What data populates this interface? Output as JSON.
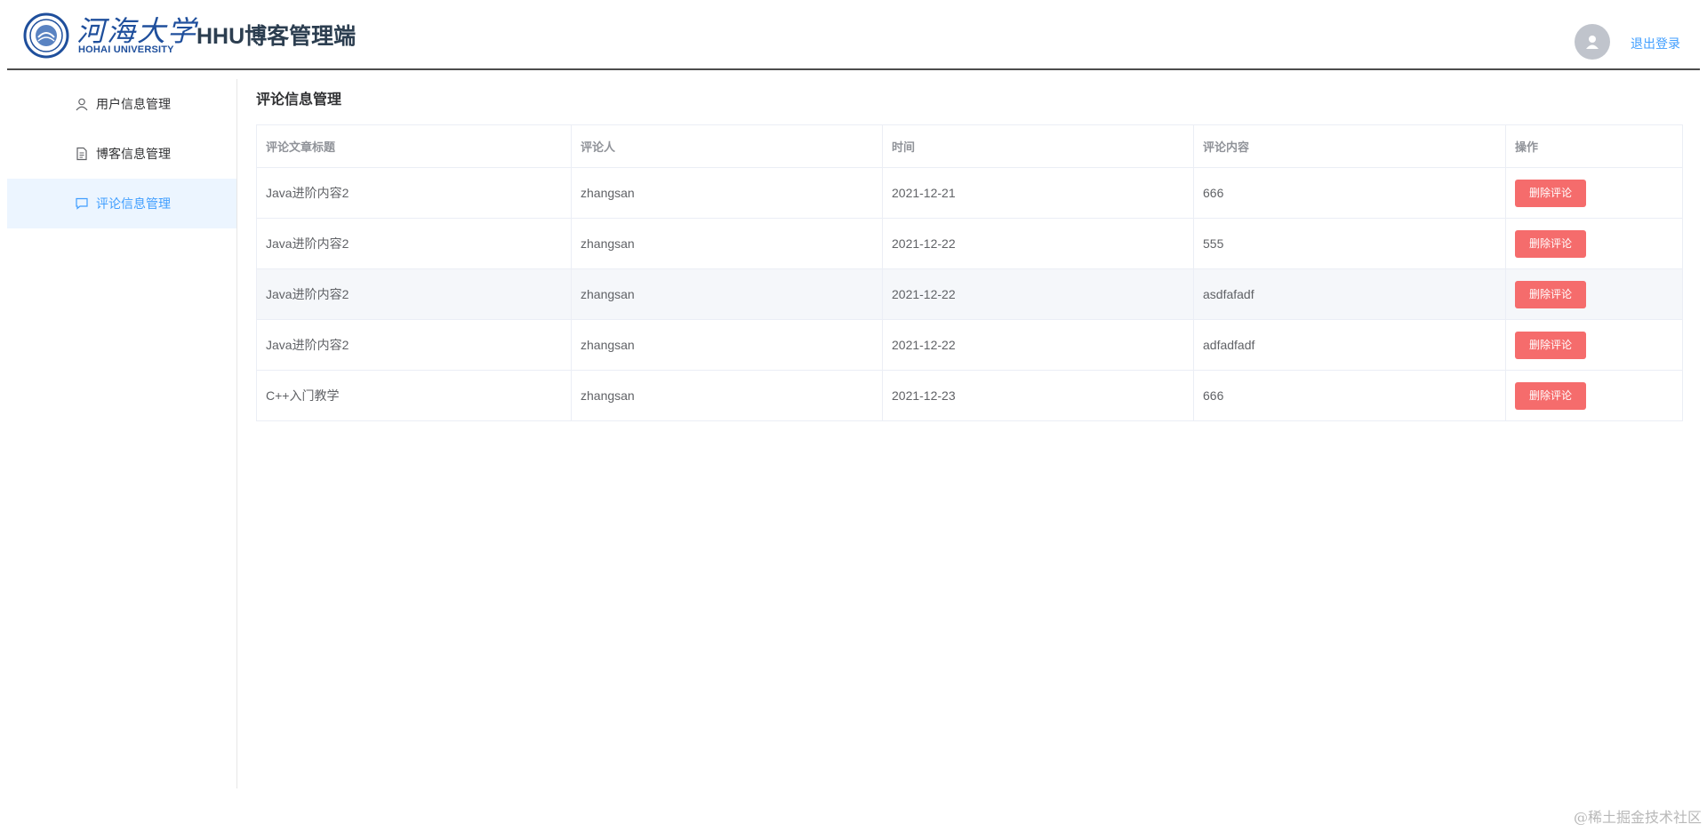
{
  "header": {
    "logo": {
      "chinese": "河海大学",
      "english": "HOHAI UNIVERSITY"
    },
    "app_title": "HHU博客管理端",
    "avatar_icon": "user-avatar-icon",
    "logout_label": "退出登录"
  },
  "sidebar": {
    "items": [
      {
        "label": "用户信息管理",
        "icon": "user-icon",
        "active": false
      },
      {
        "label": "博客信息管理",
        "icon": "document-icon",
        "active": false
      },
      {
        "label": "评论信息管理",
        "icon": "chat-bubble-icon",
        "active": true
      }
    ]
  },
  "main": {
    "title": "评论信息管理",
    "table": {
      "columns": [
        "评论文章标题",
        "评论人",
        "时间",
        "评论内容",
        "操作"
      ],
      "rows": [
        {
          "article": "Java进阶内容2",
          "author": "zhangsan",
          "time": "2021-12-21",
          "content": "666",
          "action": "删除评论"
        },
        {
          "article": "Java进阶内容2",
          "author": "zhangsan",
          "time": "2021-12-22",
          "content": "555",
          "action": "删除评论"
        },
        {
          "article": "Java进阶内容2",
          "author": "zhangsan",
          "time": "2021-12-22",
          "content": "asdfafadf",
          "action": "删除评论"
        },
        {
          "article": "Java进阶内容2",
          "author": "zhangsan",
          "time": "2021-12-22",
          "content": "adfadfadf",
          "action": "删除评论"
        },
        {
          "article": "C++入门教学",
          "author": "zhangsan",
          "time": "2021-12-23",
          "content": "666",
          "action": "删除评论"
        }
      ]
    }
  },
  "watermark": "@稀土掘金技术社区",
  "colors": {
    "accent": "#409eff",
    "active_bg": "#ecf5ff",
    "danger": "#f56c6c",
    "logo_blue": "#1f4f9c"
  }
}
